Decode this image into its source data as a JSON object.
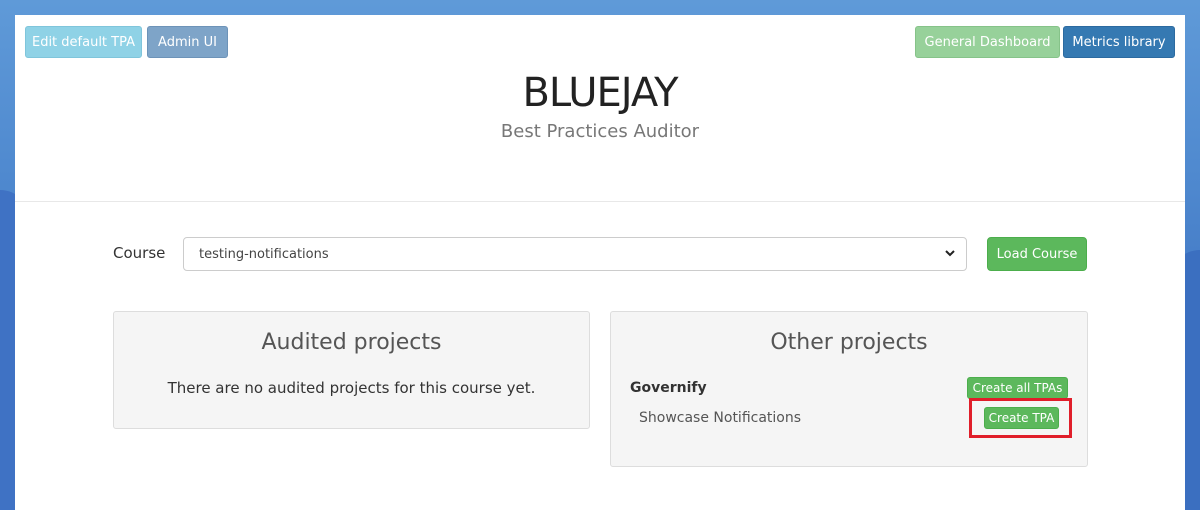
{
  "toolbar": {
    "edit_default_tpa": "Edit default TPA",
    "admin_ui": "Admin UI",
    "general_dashboard": "General Dashboard",
    "metrics_library": "Metrics library"
  },
  "header": {
    "title": "BLUEJAY",
    "subtitle": "Best Practices Auditor"
  },
  "course": {
    "label": "Course",
    "selected": "testing-notifications",
    "load_button": "Load Course"
  },
  "audited": {
    "title": "Audited projects",
    "empty_message": "There are no audited projects for this course yet."
  },
  "other": {
    "title": "Other projects",
    "groups": [
      {
        "name": "Governify",
        "create_all_label": "Create all TPAs",
        "projects": [
          {
            "name": "Showcase Notifications",
            "create_label": "Create TPA"
          }
        ]
      }
    ]
  },
  "colors": {
    "accent_green": "#5cb85c",
    "highlight_red": "#e01e2a",
    "metrics_blue": "#3579b2"
  }
}
